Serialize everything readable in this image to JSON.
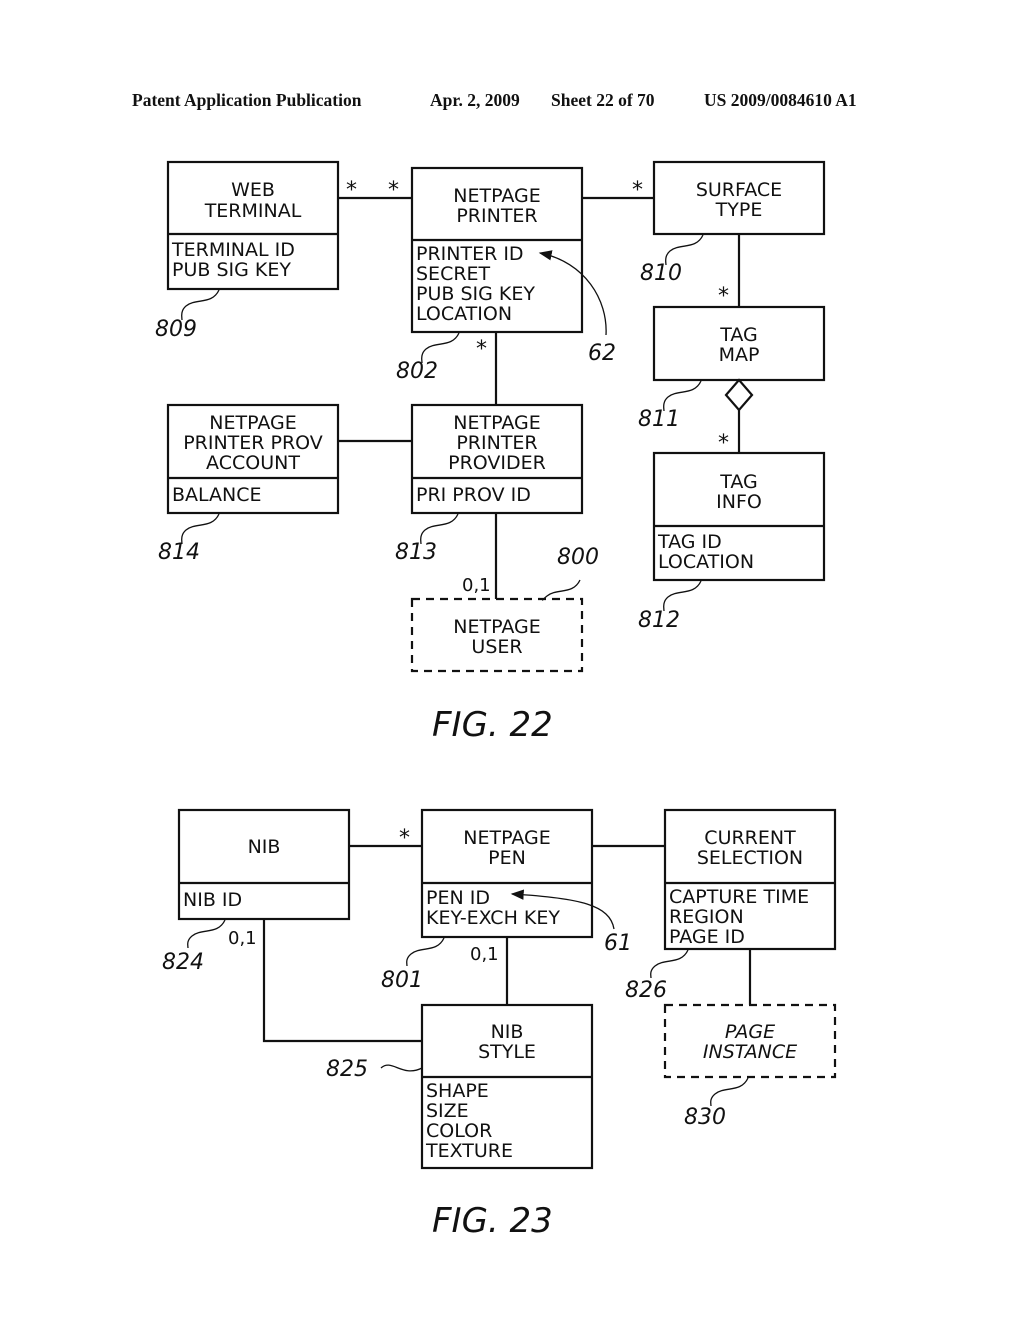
{
  "header": {
    "left": "Patent Application Publication",
    "date": "Apr. 2, 2009",
    "sheet": "Sheet 22 of 70",
    "pub_number": "US 2009/0084610 A1"
  },
  "fig22": {
    "caption": "FIG. 22",
    "classes": {
      "web_terminal": {
        "name": [
          "WEB",
          "TERMINAL"
        ],
        "attrs": [
          "TERMINAL ID",
          "PUB SIG KEY"
        ],
        "ref": "809"
      },
      "netpage_printer": {
        "name": [
          "NETPAGE",
          "PRINTER"
        ],
        "attrs": [
          "PRINTER ID",
          "SECRET",
          "PUB SIG KEY",
          "LOCATION"
        ],
        "ref": "802"
      },
      "surface_type": {
        "name": [
          "SURFACE",
          "TYPE"
        ],
        "ref": "810"
      },
      "tag_map": {
        "name": [
          "TAG",
          "MAP"
        ],
        "ref": "811"
      },
      "tag_info": {
        "name": [
          "TAG",
          "INFO"
        ],
        "attrs": [
          "TAG ID",
          "LOCATION"
        ],
        "ref": "812"
      },
      "printer_prov_account": {
        "name": [
          "NETPAGE",
          "PRINTER PROV",
          "ACCOUNT"
        ],
        "attrs": [
          "BALANCE"
        ],
        "ref": "814"
      },
      "printer_provider": {
        "name": [
          "NETPAGE",
          "PRINTER",
          "PROVIDER"
        ],
        "attrs": [
          "PRI PROV ID"
        ],
        "ref": "813"
      },
      "netpage_user": {
        "name": [
          "NETPAGE",
          "USER"
        ],
        "ref": "800"
      }
    },
    "multiplicities": {
      "web_terminal_side": "*",
      "printer_side_web": "*",
      "surface_side": "*",
      "tag_map_top": "*",
      "tag_info_top": "*",
      "printer_bottom": "*",
      "user_top": "0,1"
    },
    "annotation_ref": "62"
  },
  "fig23": {
    "caption": "FIG. 23",
    "classes": {
      "nib": {
        "name": [
          "NIB"
        ],
        "attrs": [
          "NIB ID"
        ],
        "ref": "824"
      },
      "netpage_pen": {
        "name": [
          "NETPAGE",
          "PEN"
        ],
        "attrs": [
          "PEN ID",
          "KEY-EXCH KEY"
        ],
        "ref": "801"
      },
      "current_selection": {
        "name": [
          "CURRENT",
          "SELECTION"
        ],
        "attrs": [
          "CAPTURE TIME",
          "REGION",
          "PAGE ID"
        ],
        "ref": "826"
      },
      "nib_style": {
        "name": [
          "NIB",
          "STYLE"
        ],
        "attrs": [
          "SHAPE",
          "SIZE",
          "COLOR",
          "TEXTURE"
        ],
        "ref": "825"
      },
      "page_instance": {
        "name": [
          "PAGE",
          "INSTANCE"
        ],
        "ref": "830"
      }
    },
    "multiplicities": {
      "pen_side_nib": "*",
      "nib_bottom": "0,1",
      "pen_bottom": "0,1"
    },
    "annotation_ref": "61"
  }
}
